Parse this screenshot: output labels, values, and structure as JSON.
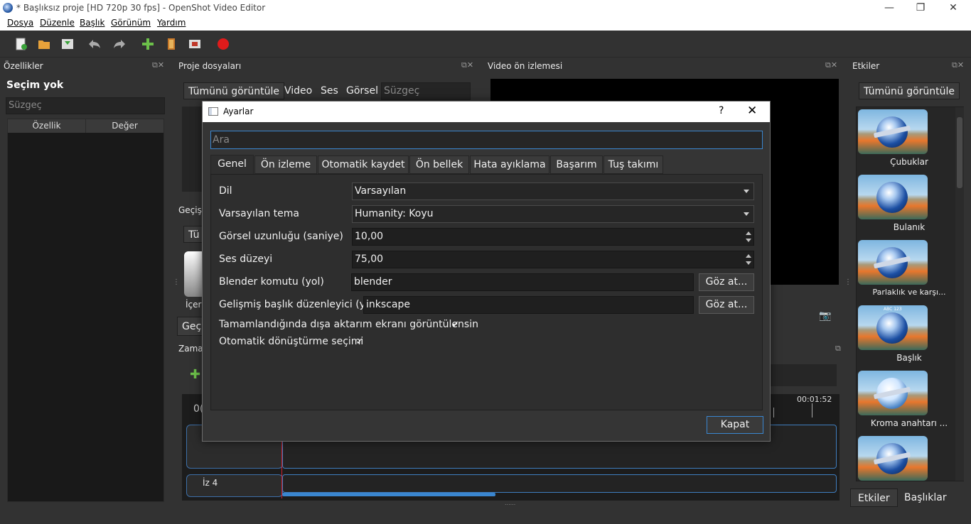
{
  "window": {
    "title": "* Başlıksız proje [HD 720p 30 fps] - OpenShot Video Editor"
  },
  "menu": [
    "Dosya",
    "Düzenle",
    "Başlık",
    "Görünüm",
    "Yardım"
  ],
  "toolbar_icons": [
    "new-file-icon",
    "open-folder-icon",
    "save-icon",
    "undo-icon",
    "redo-icon",
    "import-add-icon",
    "choose-profile-icon",
    "fullscreen-icon",
    "record-icon"
  ],
  "properties": {
    "title": "Özellikler",
    "selection": "Seçim yok",
    "filter_placeholder": "Süzgeç",
    "col_property": "Özellik",
    "col_value": "Değer"
  },
  "project_files": {
    "title": "Proje dosyaları",
    "show_all": "Tümünü görüntüle",
    "video": "Video",
    "audio": "Ses",
    "image": "Görsel",
    "filter_placeholder": "Süzgeç"
  },
  "transitions_partial": {
    "label": "Geçişl",
    "show_all": "Tü",
    "item": "İçer",
    "tab": "Geç"
  },
  "timeline_partial": {
    "label": "Zama",
    "timecode": "00:01:52",
    "left_code": "0(",
    "track_name": "İz 4"
  },
  "preview": {
    "title": "Video ön izlemesi"
  },
  "effects": {
    "title": "Etkiler",
    "show_all": "Tümünü görüntüle",
    "items": [
      "Çubuklar",
      "Bulanık",
      "Parlaklık ve karşı...",
      "Başlık",
      "Kroma anahtarı ..."
    ],
    "title_thumb_text": "ABC 123",
    "tab_effects": "Etkiler",
    "tab_titles": "Başlıklar"
  },
  "dialog": {
    "title": "Ayarlar",
    "help": "?",
    "close": "✕",
    "search_placeholder": "Ara",
    "tabs": [
      "Genel",
      "Ön izleme",
      "Otomatik kaydet",
      "Ön bellek",
      "Hata ayıklama",
      "Başarım",
      "Tuş takımı"
    ],
    "active_tab": "Genel",
    "rows": {
      "language_label": "Dil",
      "language_value": "Varsayılan",
      "theme_label": "Varsayılan tema",
      "theme_value": "Humanity: Koyu",
      "image_length_label": "Görsel uzunluğu (saniye)",
      "image_length_value": "10,00",
      "volume_label": "Ses düzeyi",
      "volume_value": "75,00",
      "blender_label": "Blender komutu (yol)",
      "blender_value": "blender",
      "title_editor_label": "Gelişmiş başlık düzenleyici (yol)",
      "title_editor_value": "inkscape",
      "browse": "Göz at...",
      "export_check_label": "Tamamlandığında dışa aktarım ekranı görüntülensin",
      "auto_convert_label": "Otomatik dönüştürme seçimi",
      "checkmark": "✓"
    },
    "close_button": "Kapat"
  }
}
